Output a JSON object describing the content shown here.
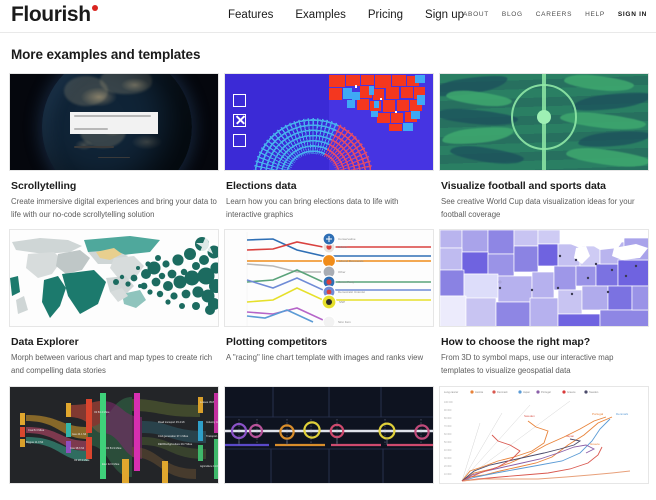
{
  "header": {
    "logo_text": "Flourish",
    "logo_dot_color": "#d9241f",
    "main_nav": [
      {
        "label": "Features"
      },
      {
        "label": "Examples"
      },
      {
        "label": "Pricing"
      },
      {
        "label": "Sign up"
      }
    ],
    "util_nav": [
      {
        "label": "ABOUT",
        "strong": false
      },
      {
        "label": "BLOG",
        "strong": false
      },
      {
        "label": "CAREERS",
        "strong": false
      },
      {
        "label": "HELP",
        "strong": false
      },
      {
        "label": "SIGN IN",
        "strong": true
      }
    ]
  },
  "page": {
    "title": "More examples and templates"
  },
  "cards": [
    {
      "title": "Scrollytelling",
      "description": "Create immersive digital experiences and bring your data to life with our no-code scrollytelling solution",
      "thumbnail": "earth-at-night-scrollytelling"
    },
    {
      "title": "Elections data",
      "description": "Learn how you can bring elections data to life with interactive graphics",
      "thumbnail": "election-parliament-and-us-map"
    },
    {
      "title": "Visualize football and sports data",
      "description": "See creative World Cup data visualization ideas for your football coverage",
      "thumbnail": "football-pitch"
    },
    {
      "title": "Data Explorer",
      "description": "Morph between various chart and map types to create rich and compelling data stories",
      "thumbnail": "world-map-to-circles"
    },
    {
      "title": "Plotting competitors",
      "description": "A \"racing\" line chart template with images and ranks view",
      "thumbnail": "racing-line-chart"
    },
    {
      "title": "How to choose the right map?",
      "description": "From 3D to symbol maps, use our interactive map templates to visualize geospatial data",
      "thumbnail": "us-states-choropleth"
    },
    {
      "title": "",
      "description": "",
      "thumbnail": "dark-sankey-diagram"
    },
    {
      "title": "",
      "description": "",
      "thumbnail": "dark-timeline-chart"
    },
    {
      "title": "",
      "description": "",
      "thumbnail": "connected-scatter-lines"
    }
  ],
  "thumb_colors": {
    "scrollytelling_bg": "#05070d",
    "elections_bg": "#3b2ad6",
    "elections_red": "#f4371f",
    "elections_blue": "#3fa9f5",
    "football_green": "#2a7f63",
    "football_line": "#8fe8a6",
    "explorer_teal": "#1b7a6e",
    "usmap_purple": "#6a5de0",
    "sankey_bg": "#1d1f22",
    "timeline_bg": "#0e1320"
  },
  "racing_chart": {
    "type": "line",
    "series": [
      {
        "name": "Conservative",
        "color": "#2f6fb5"
      },
      {
        "name": "Labour",
        "color": "#d9413f"
      },
      {
        "name": "Liberal Democrats",
        "color": "#f08c1a"
      },
      {
        "name": "Other",
        "color": "#9a9a9a"
      },
      {
        "name": "Green Party",
        "color": "#5aa37a"
      },
      {
        "name": "Democratic Unionist",
        "color": "#6f8bd6"
      },
      {
        "name": "SNP",
        "color": "#e6e02b"
      },
      {
        "name": "Sinn Fein",
        "color": "#7d4ea8"
      }
    ]
  },
  "scatter_chart": {
    "type": "line",
    "legend": [
      {
        "name": "Austria",
        "color": "#e8833a"
      },
      {
        "name": "Denmark",
        "color": "#d9584f"
      },
      {
        "name": "Japan",
        "color": "#5b9bd5"
      },
      {
        "name": "Portugal",
        "color": "#8a5fa8"
      },
      {
        "name": "Greece",
        "color": "#d93a3a"
      },
      {
        "name": "Sweden",
        "color": "#4a4a6a"
      }
    ],
    "annotations": [
      {
        "text": "Sweden",
        "color": "#d9584f"
      },
      {
        "text": "Portugal",
        "color": "#e8833a"
      },
      {
        "text": "Denmark",
        "color": "#5b9bd5"
      },
      {
        "text": "Japan",
        "color": "#d9584f"
      },
      {
        "text": "Greece",
        "color": "#e8833a"
      }
    ]
  }
}
